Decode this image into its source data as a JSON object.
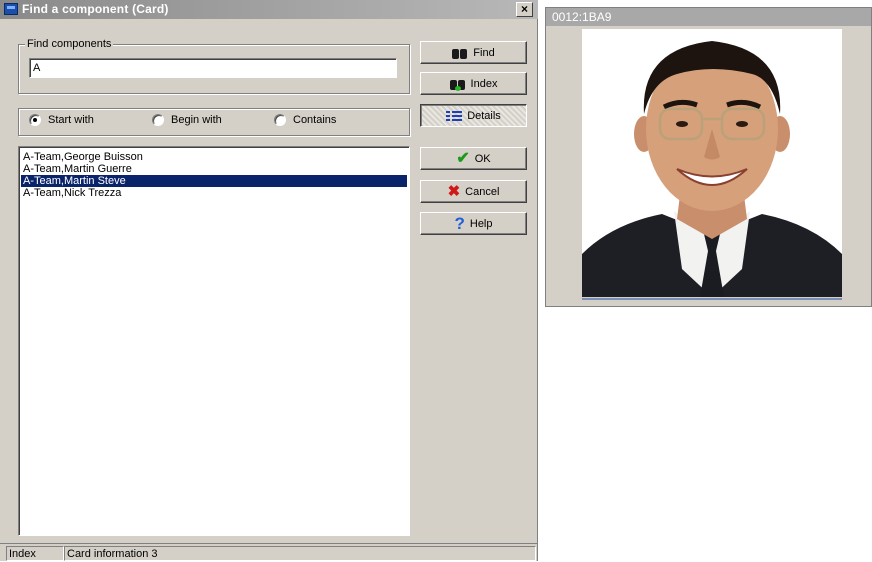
{
  "dialog": {
    "title": "Find a component (Card)",
    "close_glyph": "×"
  },
  "find_group": {
    "label": "Find components",
    "input_value": "A"
  },
  "search_mode": {
    "options": [
      "Start with",
      "Begin with",
      "Contains"
    ],
    "selected": "Start with"
  },
  "results": {
    "items": [
      "A-Team,George Buisson",
      "A-Team,Martin Guerre",
      "A-Team,Martin Steve",
      "A-Team,Nick Trezza"
    ],
    "selected_index": 2
  },
  "buttons": {
    "find": "Find",
    "index": "Index",
    "details": "Details",
    "ok": "OK",
    "cancel": "Cancel",
    "help": "Help"
  },
  "statusbar": {
    "mode": "Index",
    "info": "Card information 3"
  },
  "photo_window": {
    "title": "0012:1BA9"
  },
  "colors": {
    "selection": "#0a246a",
    "face": "#d4d0c8"
  }
}
